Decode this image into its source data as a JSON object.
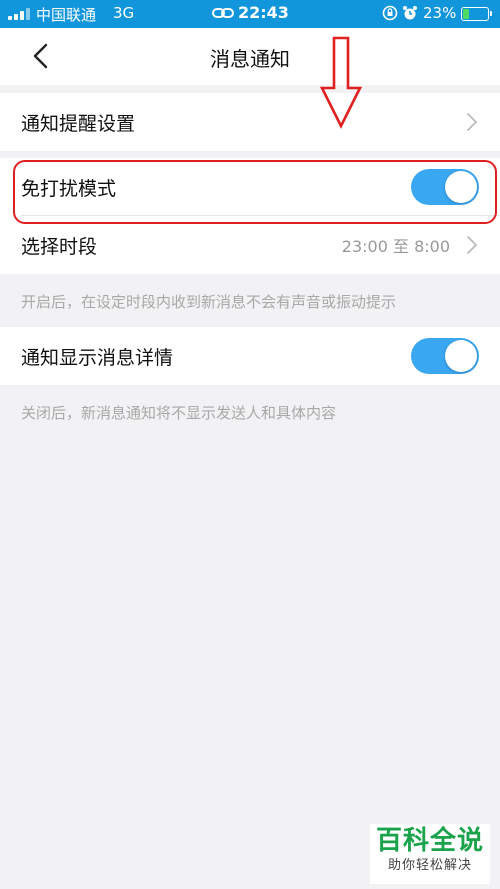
{
  "status_bar": {
    "carrier": "中国联通",
    "network": "3G",
    "time": "22:43",
    "battery_percent": "23%",
    "background_color": "#1296db"
  },
  "nav": {
    "title": "消息通知",
    "back_icon": "chevron-left-icon"
  },
  "settings": {
    "notification_reminder": {
      "label": "通知提醒设置"
    },
    "do_not_disturb": {
      "label": "免打扰模式",
      "enabled": true
    },
    "time_range": {
      "label": "选择时段",
      "value": "23:00 至 8:00"
    },
    "dnd_hint": "开启后，在设定时段内收到新消息不会有声音或振动提示",
    "show_details": {
      "label": "通知显示消息详情",
      "enabled": true
    },
    "details_hint": "关闭后，新消息通知将不显示发送人和具体内容"
  },
  "watermark": {
    "title": "百科全说",
    "subtitle": "助你轻松解决"
  },
  "colors": {
    "accent": "#3aa7f1",
    "annotation": "#e02020",
    "watermark": "#1aa34a"
  }
}
